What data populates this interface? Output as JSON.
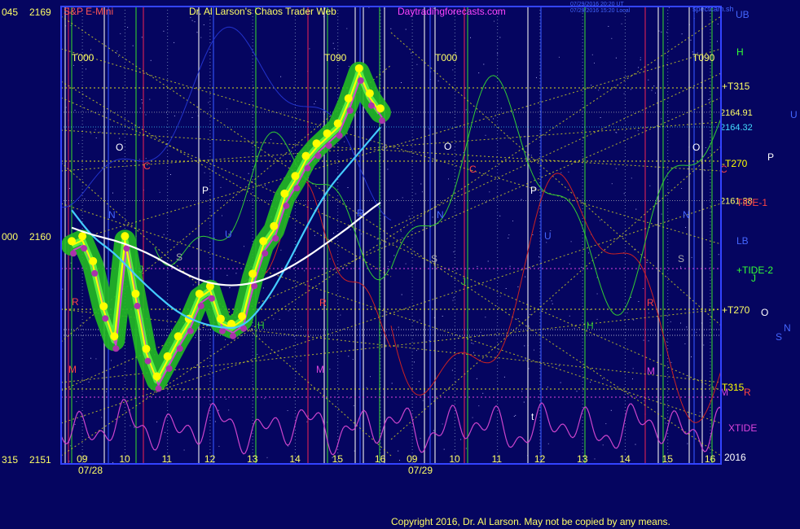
{
  "header": {
    "instrument": "S&P E-Mini",
    "title": "Dr. Al Larson's Chaos Trader Web",
    "site": "Daytradingforecasts.com",
    "stamp_line1": "07/29/2016 20:20 UT",
    "stamp_line2": "07/29/2016 15:20 Local",
    "corner_tag": "spectcam.sh",
    "price_top_prefix": "045",
    "price_top": "2169",
    "price_mid_prefix": "000",
    "price_mid": "2160",
    "price_bottom_prefix": "315",
    "price_bottom": "2151"
  },
  "footer": {
    "copyright": "Copyright 2016, Dr. Al Larson. May not be copied by any means."
  },
  "colors": {
    "background": "#050560",
    "plot_border": "#3344ff",
    "price": "#ffff00",
    "price_halo": "#22bb22",
    "fast_avg": "#44ccff",
    "slow_avg": "#ffffff",
    "xtide": "#cc44cc",
    "tide_green": "#33cc33",
    "tide_red": "#cc2222",
    "grid_yellow": "#dddd22",
    "vline_red": "#dd2255",
    "vline_green": "#33cc33",
    "vline_white": "#eeeeee",
    "vline_blue": "#3355ff",
    "text_yellow": "#ffff66",
    "text_magenta": "#dd44dd",
    "text_cyan": "#44ddff"
  },
  "chart_data": {
    "type": "line",
    "title": "S&P E-Mini",
    "xlabel": "",
    "ylabel": "",
    "ylim": [
      2151,
      2169
    ],
    "grid": true,
    "days": [
      {
        "date": "07/28",
        "hour_ticks": [
          "09",
          "10",
          "11",
          "12",
          "13",
          "14",
          "15",
          "16"
        ]
      },
      {
        "date": "07/29",
        "hour_ticks": [
          "09",
          "10",
          "11",
          "12",
          "13",
          "14",
          "15",
          "16"
        ]
      }
    ],
    "price_levels": [
      {
        "label": "2164.91",
        "value": 2164.91
      },
      {
        "label": "2164.32",
        "value": 2164.32
      },
      {
        "label": "2161.38",
        "value": 2161.38
      }
    ],
    "series": [
      {
        "name": "price",
        "x": [
          8.75,
          9.0,
          9.25,
          9.5,
          9.75,
          10.0,
          10.25,
          10.5,
          10.75,
          11.0,
          11.25,
          11.5,
          11.75,
          12.0,
          12.25,
          12.5,
          12.75,
          13.0,
          13.25,
          13.5,
          13.75,
          14.0,
          14.25,
          14.5,
          14.75,
          15.0,
          15.25,
          15.5,
          15.75,
          16.0
        ],
        "values": [
          2159.6,
          2159.8,
          2158.8,
          2157.0,
          2155.8,
          2159.8,
          2157.5,
          2155.3,
          2154.2,
          2155.0,
          2155.8,
          2156.5,
          2157.5,
          2157.8,
          2156.5,
          2156.3,
          2156.6,
          2158.3,
          2159.6,
          2160.2,
          2161.5,
          2162.2,
          2163.0,
          2163.5,
          2163.9,
          2164.3,
          2165.3,
          2166.5,
          2165.5,
          2164.9
        ]
      },
      {
        "name": "fast average",
        "x": [
          8.75,
          9.25,
          9.75,
          10.25,
          10.75,
          11.25,
          11.75,
          12.25,
          12.75,
          13.25,
          13.75,
          14.25,
          14.75,
          15.25,
          15.75,
          16.0
        ],
        "values": [
          2161.0,
          2159.9,
          2159.3,
          2158.4,
          2157.6,
          2156.9,
          2156.5,
          2156.3,
          2156.3,
          2157.2,
          2158.6,
          2160.3,
          2161.8,
          2162.8,
          2163.8,
          2164.3
        ]
      },
      {
        "name": "slow average",
        "x": [
          8.75,
          9.25,
          9.75,
          10.25,
          10.75,
          11.25,
          11.75,
          12.25,
          12.75,
          13.25,
          13.75,
          14.25,
          14.75,
          15.25,
          15.75,
          16.0
        ],
        "values": [
          2160.3,
          2160.0,
          2159.8,
          2159.5,
          2159.1,
          2158.6,
          2158.2,
          2158.0,
          2158.0,
          2158.2,
          2158.6,
          2159.1,
          2159.7,
          2160.3,
          2161.0,
          2161.3
        ]
      }
    ]
  },
  "annotations": {
    "time_labels": [
      "T000",
      "T090",
      "T000",
      "T090"
    ],
    "right_labels": [
      "UB",
      "H",
      "+T315",
      "U",
      "P",
      "-T270",
      "C",
      "TIDE-1",
      "LB",
      "+TIDE-2",
      "J",
      "+T270",
      "O",
      "N",
      "S",
      "T315",
      "M",
      "R",
      "XTIDE",
      "2016"
    ],
    "plot_letters": [
      "O",
      "C",
      "P",
      "N",
      "U",
      "S",
      "J",
      "R",
      "H",
      "M",
      "R",
      "M",
      "O",
      "C",
      "P",
      "N",
      "U",
      "S",
      "J",
      "R",
      "H",
      "M",
      "R",
      "O",
      "N",
      "S",
      "t"
    ]
  }
}
